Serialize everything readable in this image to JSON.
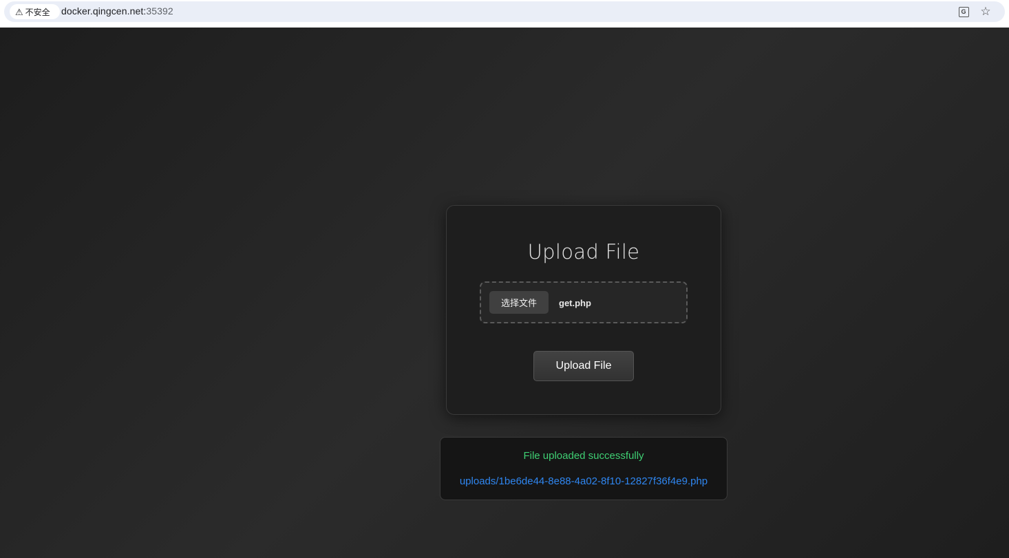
{
  "browser": {
    "security_label": "不安全",
    "url_host": "docker.qingcen.net:",
    "url_port": "35392",
    "icons": [
      "warning-icon",
      "translate-icon",
      "star-icon"
    ]
  },
  "upload_card": {
    "title": "Upload File",
    "choose_file_label": "选择文件",
    "selected_file": "get.php",
    "submit_label": "Upload File"
  },
  "result": {
    "message": "File uploaded successfully",
    "link_text": "uploads/1be6de44-8e88-4a02-8f10-12827f36f4e9.php"
  },
  "colors": {
    "success": "#3fcf73",
    "link": "#2f86f0",
    "background": "#1e1e1e"
  }
}
